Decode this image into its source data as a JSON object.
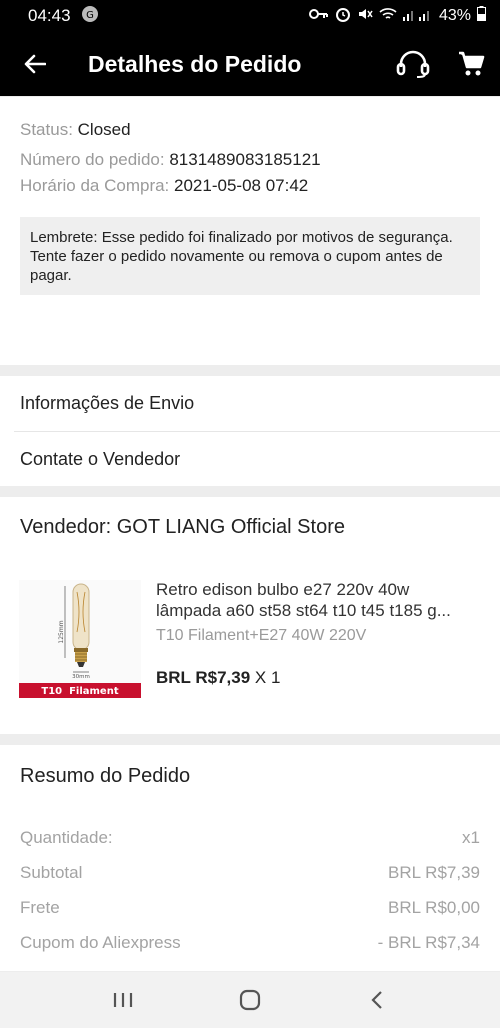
{
  "status_bar": {
    "time": "04:43",
    "battery": "43%"
  },
  "header": {
    "title": "Detalhes do Pedido"
  },
  "order": {
    "status_label": "Status:",
    "status_value": "Closed",
    "number_label": "Número do pedido:",
    "number_value": "8131489083185121",
    "time_label": "Horário da Compra:",
    "time_value": "2021-05-08 07:42",
    "reminder": "Lembrete: Esse pedido foi finalizado por motivos de segurança. Tente fazer o pedido novamente ou remova o cupom antes de pagar."
  },
  "links": {
    "shipping": "Informações de Envio",
    "contact": "Contate o Vendedor"
  },
  "seller": {
    "label": "Vendedor: GOT LIANG Official Store",
    "product": {
      "title_line1": "Retro edison bulbo e27 220v 40w",
      "title_line2": "lâmpada a60 st58 st64 t10 t45 t185 g...",
      "variant": "T10 Filament+E27 40W 220V",
      "price": "BRL R$7,39",
      "quantity": "X 1",
      "image_banner": "T10  Filament",
      "image_dim_height": "125mm",
      "image_dim_width": "30mm"
    }
  },
  "summary": {
    "title": "Resumo do Pedido",
    "rows": [
      {
        "label": "Quantidade:",
        "value": "x1"
      },
      {
        "label": "Subtotal",
        "value": "BRL R$7,39"
      },
      {
        "label": "Frete",
        "value": "BRL R$0,00"
      },
      {
        "label": "Cupom do Aliexpress",
        "value": "- BRL R$7,34"
      }
    ]
  },
  "colors": {
    "header_bg": "#000000",
    "banner_red": "#c8102e",
    "muted_text": "#9a9a9a"
  }
}
